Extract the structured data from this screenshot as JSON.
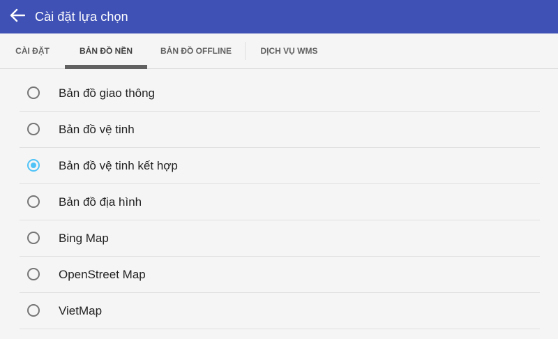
{
  "header": {
    "title": "Cài đặt lựa chọn",
    "back_icon": "arrow-left-icon"
  },
  "tabs": [
    {
      "label": "CÀI ĐẶT",
      "active": false
    },
    {
      "label": "BẢN ĐỒ NỀN",
      "active": true
    },
    {
      "label": "BẢN ĐỒ OFFLINE",
      "active": false
    },
    {
      "label": "DỊCH VỤ WMS",
      "active": false
    }
  ],
  "options": [
    {
      "label": "Bản đồ giao thông",
      "selected": false
    },
    {
      "label": "Bản đồ vệ tinh",
      "selected": false
    },
    {
      "label": "Bản đồ vệ tinh kết hợp",
      "selected": true
    },
    {
      "label": "Bản đồ địa hình",
      "selected": false
    },
    {
      "label": "Bing Map",
      "selected": false
    },
    {
      "label": "OpenStreet Map",
      "selected": false
    },
    {
      "label": "VietMap",
      "selected": false
    }
  ],
  "colors": {
    "app_bar": "#3f51b5",
    "radio_selected": "#4fc3f7",
    "tab_indicator": "#616161"
  }
}
